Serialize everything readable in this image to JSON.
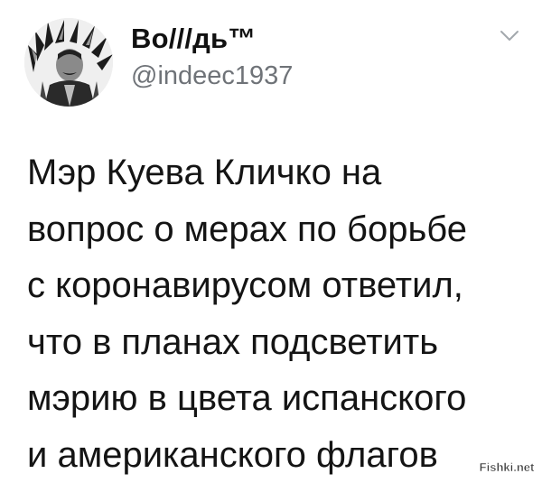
{
  "tweet": {
    "display_name": "Во///дь™",
    "handle": "@indeec1937",
    "avatar_icon": "avatar-headdress-portrait",
    "menu_icon": "chevron-down-icon",
    "text": "Мэр Куева Кличко на\nвопрос о мерах по борьбе\nс коронавирусом ответил,\nчто в планах подсветить\nмэрию в цвета испанского\nи американского флагов"
  },
  "watermark": {
    "text": "Fishki.net"
  },
  "colors": {
    "text": "#141414",
    "secondary": "#6f7378",
    "background": "#ffffff"
  }
}
